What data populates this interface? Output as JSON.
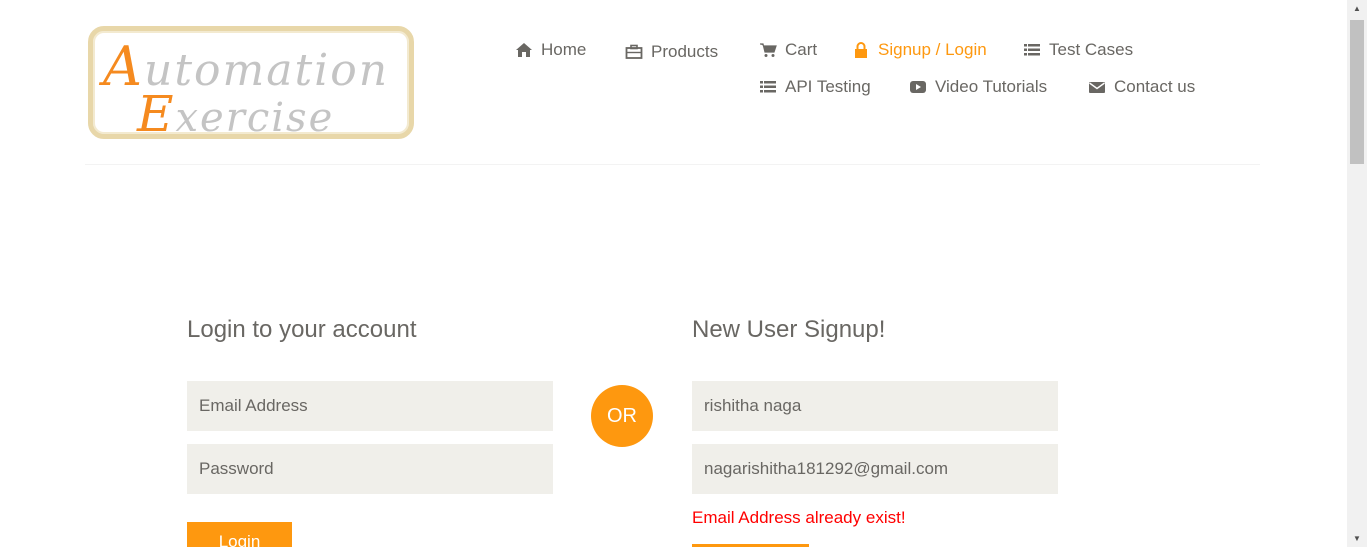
{
  "logo": {
    "line1_first": "A",
    "line1_rest": "utomation",
    "line2_first": "E",
    "line2_rest": "xercise"
  },
  "nav": {
    "home": "Home",
    "products": "Products",
    "cart": "Cart",
    "signup_login": "Signup / Login",
    "test_cases": "Test Cases",
    "api_testing": "API Testing",
    "video_tutorials": "Video Tutorials",
    "contact_us": "Contact us"
  },
  "login": {
    "title": "Login to your account",
    "email_placeholder": "Email Address",
    "password_placeholder": "Password",
    "button": "Login"
  },
  "separator": "OR",
  "signup": {
    "title": "New User Signup!",
    "name_value": "rishitha naga",
    "email_value": "nagarishitha181292@gmail.com",
    "error": "Email Address already exist!",
    "button": ""
  },
  "colors": {
    "accent": "#fe980f",
    "error": "#ff0000",
    "input_bg": "#f0efea",
    "text": "#696763"
  },
  "icons": [
    "home-icon",
    "briefcase-icon",
    "cart-icon",
    "lock-icon",
    "list-icon",
    "youtube-icon",
    "envelope-icon"
  ]
}
